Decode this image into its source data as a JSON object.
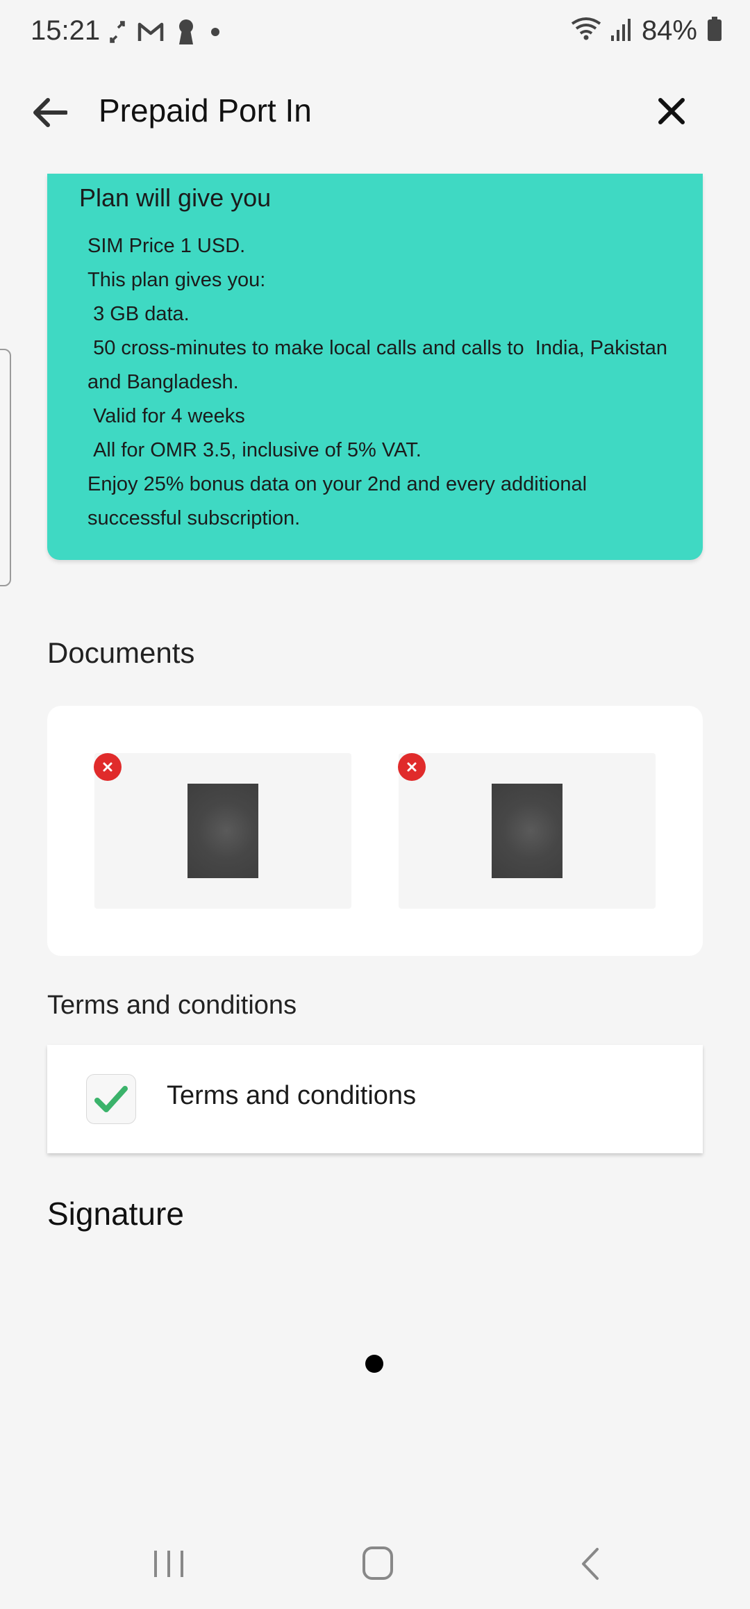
{
  "status_bar": {
    "time": "15:21",
    "battery_percent": "84%",
    "icons_left": [
      "cast-icon",
      "gmail-icon",
      "keyhole-icon",
      "dot-icon"
    ],
    "icons_right": [
      "wifi-icon",
      "signal-icon",
      "battery-icon"
    ]
  },
  "header": {
    "title": "Prepaid Port In",
    "back_icon": "arrow-left-icon",
    "close_icon": "close-icon"
  },
  "plan": {
    "title": "Plan will give you",
    "lines": [
      "SIM Price 1 USD.",
      "This plan gives you:",
      " 3 GB data.",
      " 50 cross-minutes to make local calls and calls to  India, Pakistan and Bangladesh.",
      " Valid for 4 weeks",
      " All for OMR 3.5, inclusive of 5% VAT.",
      "Enjoy 25% bonus data on your 2nd and every additional successful subscription."
    ],
    "color": "#3fd9c3"
  },
  "documents": {
    "heading": "Documents",
    "items": [
      {
        "remove_icon": "remove-icon"
      },
      {
        "remove_icon": "remove-icon"
      }
    ]
  },
  "terms": {
    "heading": "Terms and conditions",
    "checkbox_label": "Terms and conditions",
    "checked": true,
    "check_color": "#3bb36b"
  },
  "signature": {
    "heading": "Signature"
  },
  "nav_bar": {
    "icons": [
      "recents-icon",
      "home-icon",
      "back-icon"
    ]
  }
}
